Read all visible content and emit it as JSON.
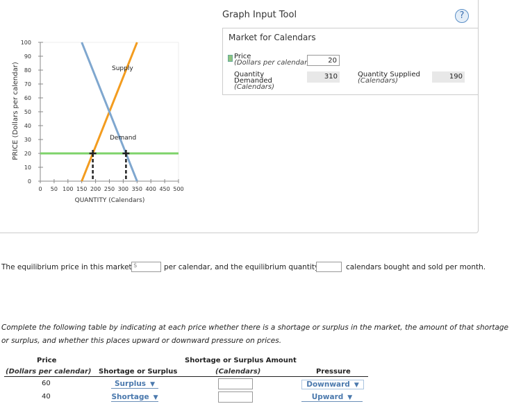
{
  "tool": {
    "title": "Graph Input Tool",
    "help_icon": "?",
    "market_title": "Market for Calendars",
    "price_label": "Price",
    "price_unit": "(Dollars per calendar)",
    "price_value": "20",
    "qd_label1": "Quantity",
    "qd_label2": "Demanded",
    "qd_unit": "(Calendars)",
    "qd_value": "310",
    "qs_label": "Quantity Supplied",
    "qs_unit": "(Calendars)",
    "qs_value": "190"
  },
  "chart": {
    "ylabel": "PRICE (Dollars per calendar)",
    "xlabel": "QUANTITY (Calendars)",
    "supply_label": "Supply",
    "demand_label": "Demand",
    "yticks": [
      "0",
      "10",
      "20",
      "30",
      "40",
      "50",
      "60",
      "70",
      "80",
      "90",
      "100"
    ],
    "xticks": [
      "0",
      "50",
      "100",
      "150",
      "200",
      "250",
      "300",
      "350",
      "400",
      "450",
      "500"
    ]
  },
  "chart_data": {
    "type": "line",
    "xlim": [
      0,
      500
    ],
    "ylim": [
      0,
      100
    ],
    "series": [
      {
        "name": "Supply",
        "points": [
          [
            150,
            0
          ],
          [
            350,
            100
          ]
        ],
        "color": "#f39c1f"
      },
      {
        "name": "Demand",
        "points": [
          [
            150,
            100
          ],
          [
            350,
            0
          ]
        ],
        "color": "#7fa7cf"
      },
      {
        "name": "Price line",
        "points": [
          [
            0,
            20
          ],
          [
            500,
            20
          ]
        ],
        "color": "#7ed36a"
      }
    ],
    "markers": [
      [
        190,
        20
      ],
      [
        310,
        20
      ]
    ]
  },
  "question": {
    "pre": "The equilibrium price in this market is",
    "currency": "$",
    "mid": "per calendar, and the equilibrium quantity is",
    "post": "calendars bought and sold per month."
  },
  "instructions": "Complete the following table by indicating at each price whether there is a shortage or surplus in the market, the amount of that shortage or surplus, and whether this places upward or downward pressure on prices.",
  "table": {
    "h_price": "Price",
    "h_price_unit": "(Dollars per calendar)",
    "h_ss": "Shortage or Surplus",
    "h_amt": "Shortage or Surplus Amount",
    "h_amt_unit": "(Calendars)",
    "h_pressure": "Pressure",
    "rows": [
      {
        "price": "60",
        "ss": "Surplus",
        "amount": "",
        "pressure": "Downward"
      },
      {
        "price": "40",
        "ss": "Shortage",
        "amount": "",
        "pressure": "Upward"
      }
    ]
  }
}
